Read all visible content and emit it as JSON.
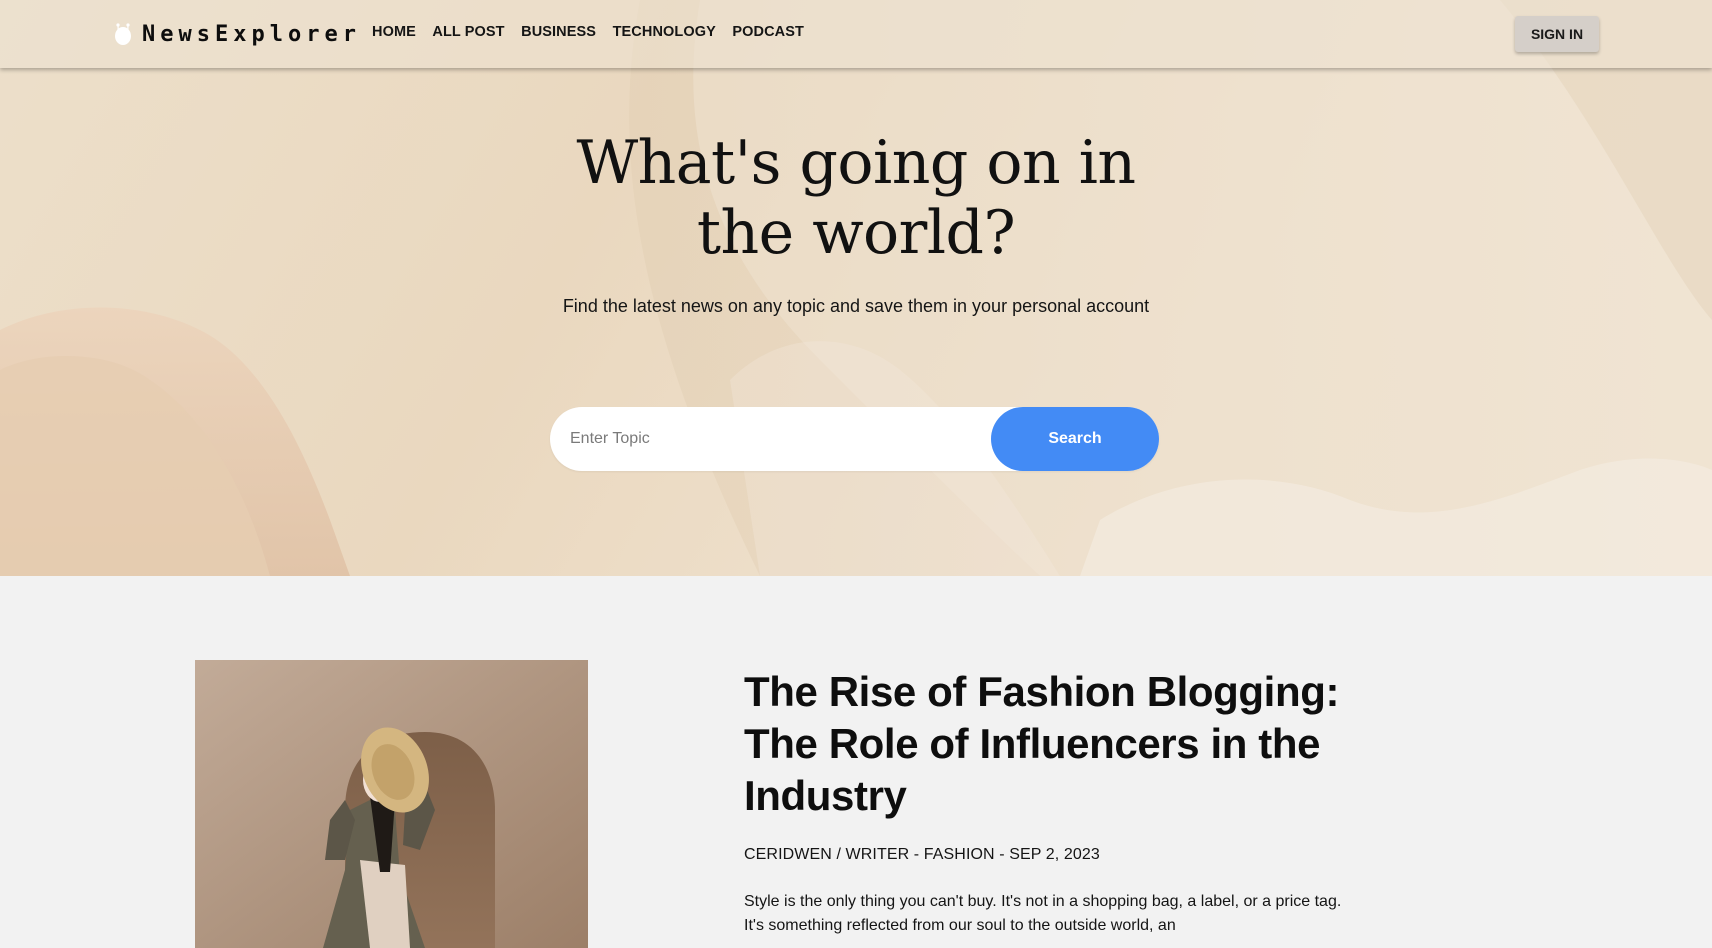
{
  "navbar": {
    "brand": "NewsExplorer",
    "brand_icon": "alien-icon",
    "links": [
      "HOME",
      "ALL POST",
      "BUSINESS",
      "TECHNOLOGY",
      "PODCAST"
    ],
    "signin_label": "SIGN IN"
  },
  "hero": {
    "title": "What's going on in the world?",
    "subtitle": "Find the latest news on any topic and save them in your personal account",
    "search": {
      "placeholder": "Enter Topic",
      "value": "",
      "button_label": "Search"
    }
  },
  "article": {
    "title": "The Rise of Fashion Blogging: The Role of Influencers in the Industry",
    "meta": "CERIDWEN / WRITER - FASHION - SEP 2, 2023",
    "excerpt": "Style is the only thing you can't buy. It's not in a shopping bag, a label, or a price tag. It's something reflected from our soul to the outside world, an"
  },
  "colors": {
    "accent": "#438bf5",
    "hero_bg": "#ead8bf",
    "page_bg": "#f2f2f2",
    "signin_bg": "#d5cfc9"
  }
}
